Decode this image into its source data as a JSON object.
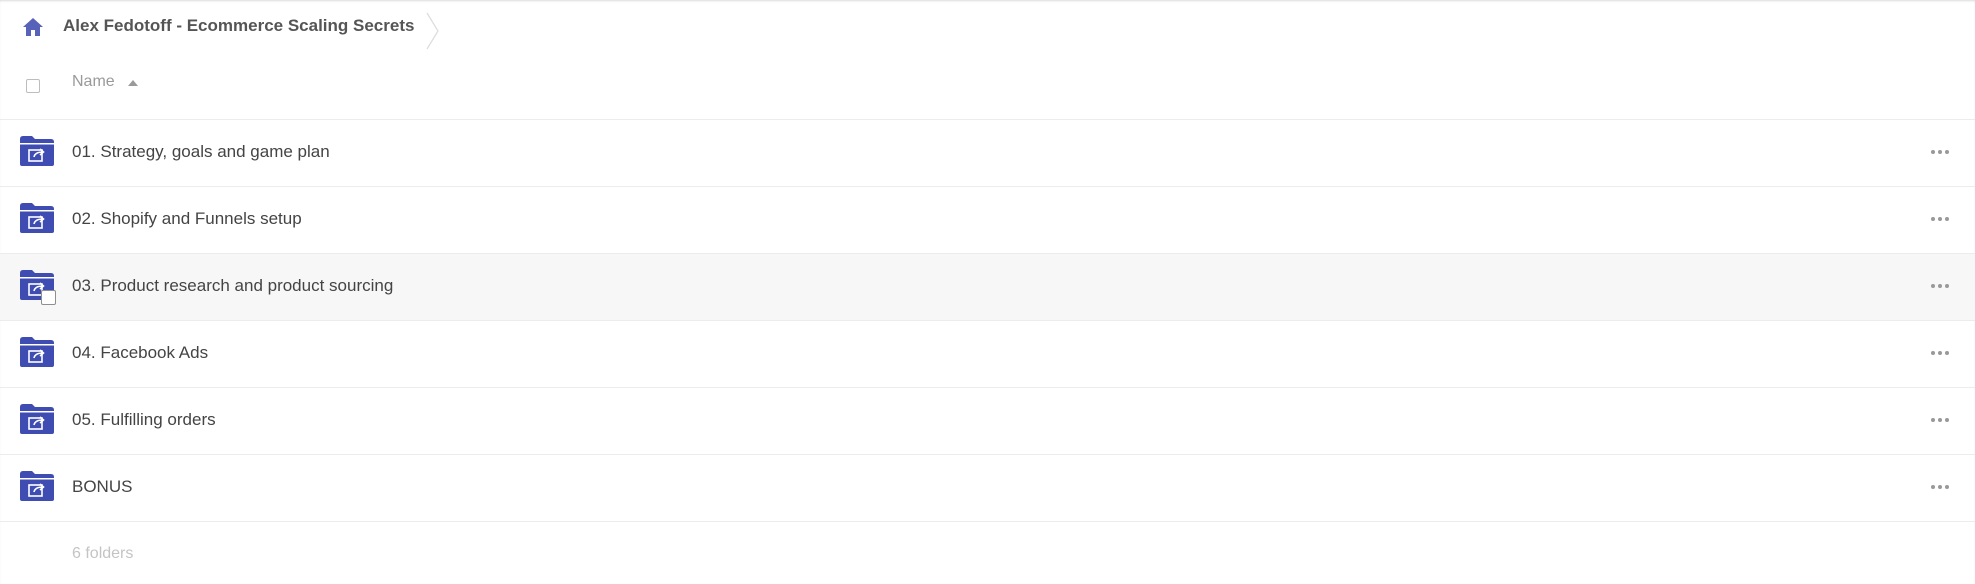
{
  "breadcrumb": {
    "home_icon": "home-icon",
    "title": "Alex Fedotoff - Ecommerce Scaling Secrets"
  },
  "list_header": {
    "name_label": "Name",
    "sort": "ascending"
  },
  "colors": {
    "folder": "#3f4cb1",
    "text": "#444444",
    "muted": "#9a9a9a"
  },
  "folders": [
    {
      "name": "01. Strategy, goals and game plan",
      "icon": "shared-folder-icon"
    },
    {
      "name": "02. Shopify and Funnels setup",
      "icon": "shared-folder-icon"
    },
    {
      "name": "03. Product research and product sourcing",
      "icon": "shared-folder-icon"
    },
    {
      "name": "04. Facebook Ads",
      "icon": "shared-folder-icon"
    },
    {
      "name": "05. Fulfilling orders",
      "icon": "shared-folder-icon"
    },
    {
      "name": "BONUS",
      "icon": "shared-folder-icon"
    }
  ],
  "footer": {
    "count_text": "6 folders"
  }
}
